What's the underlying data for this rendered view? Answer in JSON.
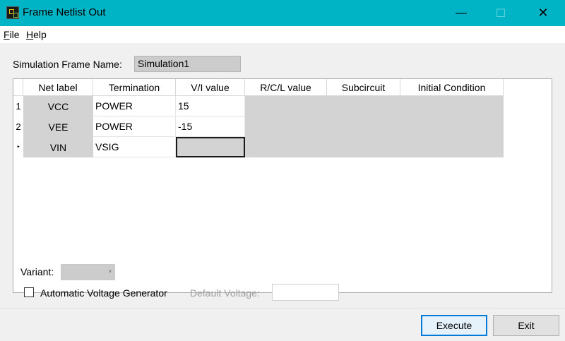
{
  "window": {
    "title": "Frame Netlist Out",
    "minimize_glyph": "—",
    "maximize_glyph": "☐",
    "close_glyph": "✕"
  },
  "menu": {
    "file": "File",
    "help": "Help"
  },
  "form": {
    "frame_name_label": "Simulation Frame Name:",
    "frame_name_value": "Simulation1"
  },
  "grid": {
    "columns": [
      "Net label",
      "Termination",
      "V/I value",
      "R/C/L value",
      "Subcircuit",
      "Initial Condition"
    ],
    "rows": [
      {
        "header": "1",
        "net_label": "VCC",
        "termination": "POWER",
        "vi_value": "15",
        "rcl_value": "",
        "subcircuit": "",
        "initial_condition": ""
      },
      {
        "header": "2",
        "net_label": "VEE",
        "termination": "POWER",
        "vi_value": "-15",
        "rcl_value": "",
        "subcircuit": "",
        "initial_condition": ""
      },
      {
        "header": "‣",
        "net_label": "VIN",
        "termination": "VSIG",
        "vi_value": "",
        "rcl_value": "",
        "subcircuit": "",
        "initial_condition": ""
      }
    ]
  },
  "bottom": {
    "variant_label": "Variant:",
    "variant_value": "",
    "auto_voltage_label": "Automatic Voltage Generator",
    "auto_voltage_checked": false,
    "default_voltage_label": "Default Voltage:",
    "default_voltage_value": ""
  },
  "buttons": {
    "execute": "Execute",
    "exit": "Exit"
  },
  "colors": {
    "titlebar": "#00b4c5",
    "readonly_cell": "#d3d3d3",
    "accent": "#0078d7"
  }
}
